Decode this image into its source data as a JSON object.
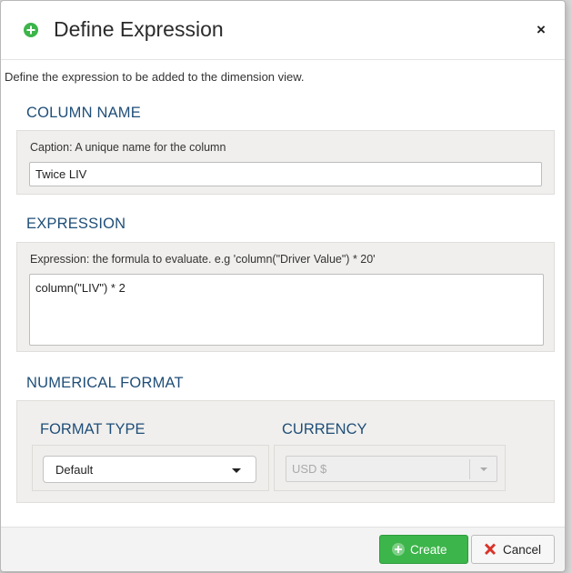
{
  "dialog": {
    "title": "Define Expression",
    "close_label": "×",
    "intro": "Define the expression to be added to the dimension view."
  },
  "column_name": {
    "heading": "COLUMN NAME",
    "caption_label": "Caption: A unique name for the column",
    "value": "Twice LIV"
  },
  "expression": {
    "heading": "EXPRESSION",
    "label": "Expression: the formula to evaluate. e.g 'column(\"Driver Value\") * 20'",
    "value": "column(\"LIV\") * 2"
  },
  "numerical_format": {
    "heading": "NUMERICAL FORMAT",
    "format_type": {
      "heading": "FORMAT TYPE",
      "selected": "Default"
    },
    "currency": {
      "heading": "CURRENCY",
      "selected": "USD $",
      "disabled": true
    }
  },
  "footer": {
    "create_label": "Create",
    "cancel_label": "Cancel"
  },
  "colors": {
    "heading": "#1f4e78",
    "create_button": "#3cb54a",
    "cancel_icon": "#d9342b",
    "panel_background": "#f0efed"
  },
  "icons": {
    "title": "plus-circle-icon",
    "create": "plus-circle-icon",
    "cancel": "x-mark-icon"
  }
}
